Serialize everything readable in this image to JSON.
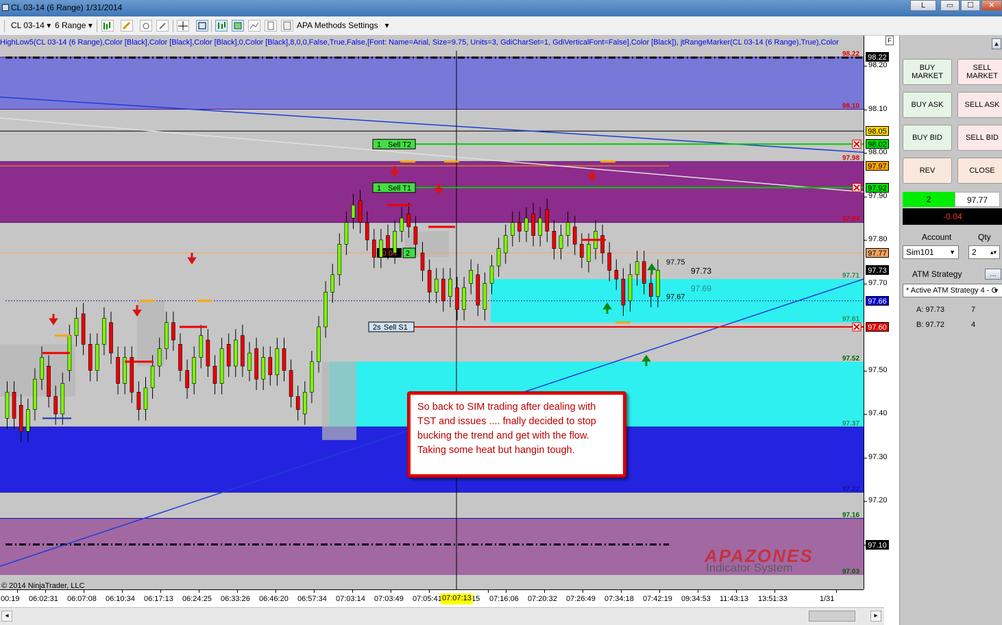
{
  "window": {
    "title": "CL 03-14 (6 Range)  1/31/2014",
    "buttons": [
      "L",
      "▭",
      "☐",
      "✕"
    ]
  },
  "toolbar": {
    "instrument": "CL 03-14",
    "period": "6 Range",
    "settings_label": "APA Methods Settings"
  },
  "chart": {
    "indicator_text": "HighLow5(CL 03-14 (6 Range),Color [Black],Color [Black],Color [Black],0,Color [Black],8,0,0,False,True,False,[Font: Name=Arial, Size=9.75, Units=3, GdiCharSet=1, GdiVerticalFont=False],Color [Black]), jtRangeMarker(CL 03-14 (6 Range),True),Color",
    "copyright": "© 2014 NinjaTrader, LLC",
    "watermark_title": "APAZONES",
    "watermark_sub": "Indicator System",
    "annotation": "So back to SIM trading after dealing with TST and issues .... fnally decided to stop bucking the trend and get with the flow.  Taking some heat but hangin tough.",
    "orders": [
      {
        "qty": "1",
        "name": "Sell T2",
        "price": 98.02
      },
      {
        "qty": "1",
        "name": "Sell T1",
        "price": 97.92
      },
      {
        "qty": "2s",
        "name": "Sell S1",
        "price": 97.6
      }
    ],
    "position_marker": {
      "pnl": "-0.04",
      "qty": "2"
    },
    "last_labels": {
      "high": "97.75",
      "last": "97.73",
      "mid": "97.69",
      "low": "97.67"
    },
    "zone_labels": [
      "98.22",
      "98.10",
      "97.98",
      "97.84",
      "97.71",
      "97.61",
      "97.52",
      "97.37",
      "97.22",
      "97.16",
      "97.03"
    ],
    "candles_open_close": [
      [
        97.39,
        97.45
      ],
      [
        97.45,
        97.39
      ],
      [
        97.42,
        97.36
      ],
      [
        97.36,
        97.41
      ],
      [
        97.41,
        97.48
      ],
      [
        97.48,
        97.53
      ],
      [
        97.51,
        97.44
      ],
      [
        97.44,
        97.4
      ],
      [
        97.4,
        97.47
      ],
      [
        97.5,
        97.58
      ],
      [
        97.58,
        97.62
      ],
      [
        97.63,
        97.56
      ],
      [
        97.56,
        97.5
      ],
      [
        97.5,
        97.56
      ],
      [
        97.56,
        97.62
      ],
      [
        97.61,
        97.54
      ],
      [
        97.53,
        97.47
      ],
      [
        97.47,
        97.53
      ],
      [
        97.53,
        97.45
      ],
      [
        97.45,
        97.41
      ],
      [
        97.41,
        97.46
      ],
      [
        97.46,
        97.51
      ],
      [
        97.51,
        97.55
      ],
      [
        97.55,
        97.61
      ],
      [
        97.61,
        97.57
      ],
      [
        97.56,
        97.5
      ],
      [
        97.5,
        97.46
      ],
      [
        97.47,
        97.53
      ],
      [
        97.53,
        97.58
      ],
      [
        97.57,
        97.51
      ],
      [
        97.51,
        97.47
      ],
      [
        97.47,
        97.55
      ],
      [
        97.56,
        97.51
      ],
      [
        97.51,
        97.57
      ],
      [
        97.58,
        97.51
      ],
      [
        97.5,
        97.54
      ],
      [
        97.55,
        97.48
      ],
      [
        97.48,
        97.53
      ],
      [
        97.53,
        97.49
      ],
      [
        97.49,
        97.55
      ],
      [
        97.55,
        97.5
      ],
      [
        97.5,
        97.44
      ],
      [
        97.44,
        97.41
      ],
      [
        97.4,
        97.45
      ],
      [
        97.45,
        97.52
      ],
      [
        97.52,
        97.6
      ],
      [
        97.6,
        97.68
      ],
      [
        97.68,
        97.72
      ],
      [
        97.72,
        97.79
      ],
      [
        97.79,
        97.84
      ],
      [
        97.85,
        97.88
      ],
      [
        97.89,
        97.84
      ],
      [
        97.84,
        97.8
      ],
      [
        97.8,
        97.76
      ],
      [
        97.76,
        97.8
      ],
      [
        97.81,
        97.78
      ],
      [
        97.77,
        97.82
      ],
      [
        97.82,
        97.85
      ],
      [
        97.86,
        97.83
      ],
      [
        97.83,
        97.79
      ],
      [
        97.77,
        97.73
      ],
      [
        97.73,
        97.68
      ],
      [
        97.68,
        97.71
      ],
      [
        97.71,
        97.66
      ],
      [
        97.67,
        97.71
      ],
      [
        97.69,
        97.64
      ],
      [
        97.64,
        97.69
      ],
      [
        97.7,
        97.73
      ],
      [
        97.72,
        97.65
      ],
      [
        97.64,
        97.7
      ],
      [
        97.7,
        97.74
      ],
      [
        97.74,
        97.78
      ],
      [
        97.77,
        97.81
      ],
      [
        97.81,
        97.84
      ],
      [
        97.84,
        97.82
      ],
      [
        97.82,
        97.85
      ],
      [
        97.86,
        97.81
      ],
      [
        97.81,
        97.85
      ],
      [
        97.87,
        97.82
      ],
      [
        97.82,
        97.78
      ],
      [
        97.78,
        97.81
      ],
      [
        97.81,
        97.84
      ],
      [
        97.83,
        97.79
      ],
      [
        97.79,
        97.76
      ],
      [
        97.75,
        97.79
      ],
      [
        97.78,
        97.82
      ],
      [
        97.81,
        97.77
      ],
      [
        97.77,
        97.73
      ],
      [
        97.73,
        97.71
      ],
      [
        97.71,
        97.65
      ],
      [
        97.66,
        97.72
      ],
      [
        97.72,
        97.75
      ],
      [
        97.75,
        97.7
      ],
      [
        97.7,
        97.67
      ],
      [
        97.67,
        97.73
      ]
    ]
  },
  "price_axis": {
    "labels": [
      "98.20",
      "98.10",
      "98.00",
      "97.90",
      "97.80",
      "97.70",
      "97.50",
      "97.40",
      "97.30",
      "97.20",
      "97.10"
    ],
    "tags": [
      {
        "text": "98.22",
        "price": 98.22,
        "bg": "#000000",
        "fg": "#ffffff"
      },
      {
        "text": "98.05",
        "price": 98.05,
        "bg": "#ffd700",
        "fg": "#000000"
      },
      {
        "text": "98.02",
        "price": 98.02,
        "bg": "#00dd00",
        "fg": "#000000"
      },
      {
        "text": "97.97",
        "price": 97.97,
        "bg": "#ffa500",
        "fg": "#000000"
      },
      {
        "text": "97.92",
        "price": 97.92,
        "bg": "#00dd00",
        "fg": "#000000"
      },
      {
        "text": "97.77",
        "price": 97.77,
        "bg": "#f4a460",
        "fg": "#000000"
      },
      {
        "text": "97.73",
        "price": 97.73,
        "bg": "#000000",
        "fg": "#ffffff"
      },
      {
        "text": "97.66",
        "price": 97.66,
        "bg": "#0000cc",
        "fg": "#ffffff"
      },
      {
        "text": "97.60",
        "price": 97.6,
        "bg": "#dd0000",
        "fg": "#ffffff"
      },
      {
        "text": "97.10",
        "price": 97.1,
        "bg": "#000000",
        "fg": "#ffffff"
      }
    ]
  },
  "time_axis": {
    "labels": [
      "00:19",
      "06:02:31",
      "06:07:08",
      "06:10:34",
      "06:17:13",
      "06:24:25",
      "06:33:26",
      "06:46:20",
      "06:57:34",
      "07:03:14",
      "07:03:49",
      "07:05:41",
      "15",
      "07:16:06",
      "07:20:32",
      "07:26:49",
      "07:34:18",
      "07:42:19",
      "09:34:53",
      "11:43:13",
      "13:51:33",
      "1/31"
    ],
    "cursor_label": "07:07:13"
  },
  "side_panel": {
    "buttons": [
      {
        "label": "BUY MARKET",
        "type": "buy"
      },
      {
        "label": "SELL MARKET",
        "type": "sell"
      },
      {
        "label": "BUY ASK",
        "type": "buy"
      },
      {
        "label": "SELL ASK",
        "type": "sell"
      },
      {
        "label": "BUY BID",
        "type": "buy"
      },
      {
        "label": "SELL BID",
        "type": "sell"
      },
      {
        "label": "REV",
        "type": "rev"
      },
      {
        "label": "CLOSE",
        "type": "close"
      }
    ],
    "position_qty": "2",
    "position_price": "97.77",
    "pnl": "-0.04",
    "account_label": "Account",
    "qty_label": "Qty",
    "account": "Sim101",
    "qty": "2",
    "atm_label": "ATM Strategy",
    "atm_button": "...",
    "atm_value": "* Active ATM Strategy 4 - C",
    "ask_label": "A: 97.73",
    "ask_size": "7",
    "bid_label": "B: 97.72",
    "bid_size": "4"
  }
}
